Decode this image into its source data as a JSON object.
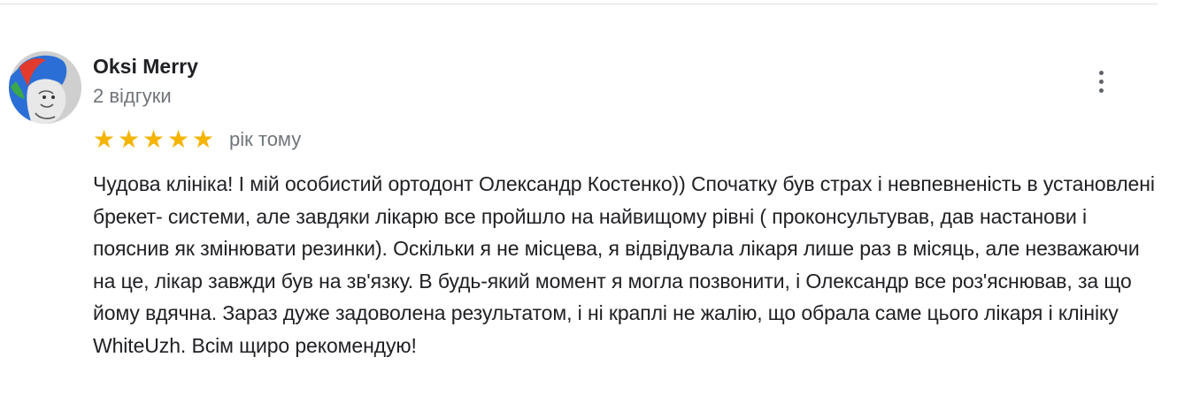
{
  "review": {
    "reviewer_name": "Oksi Merry",
    "review_count": "2 відгуки",
    "rating": 5,
    "rating_max": 5,
    "stars": [
      "★",
      "★",
      "★",
      "★",
      "★"
    ],
    "time_ago": "рік тому",
    "text": "Чудова клініка! І мій особистий ортодонт Олександр Костенко)) Спочатку був страх і невпевненість в установлені брекет- системи, але завдяки лікарю все пройшло на найвищому рівні ( проконсультував, дав настанови і пояснив як змінювати резинки). Оскільки я не місцева, я відвідувала лікаря лише раз в місяць, але незважаючи на це, лікар завжди був на зв'язку. В будь-який момент я могла позвонити, і Олександр все роз'яснював, за що йому вдячна. Зараз дуже задоволена результатом, і ні краплі не жалію, що обрала саме цього лікаря і клініку WhiteUzh. Всім щиро рекомендую!"
  },
  "icons": {
    "more": "more-vert-icon",
    "star": "star-icon"
  },
  "colors": {
    "star": "#f4b400",
    "secondary_text": "#70757a",
    "primary_text": "#202124"
  }
}
